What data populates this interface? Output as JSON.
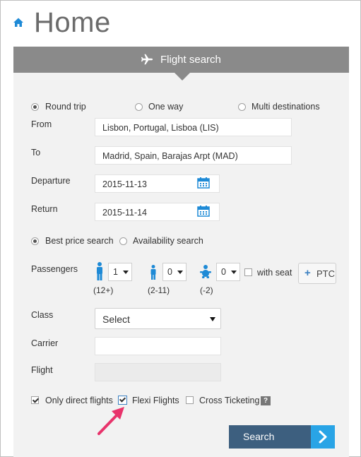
{
  "page": {
    "title": "Home"
  },
  "panel": {
    "title": "Flight search"
  },
  "trip_type": {
    "options": [
      "Round trip",
      "One way",
      "Multi destinations"
    ],
    "selected": "Round trip"
  },
  "from": {
    "label": "From",
    "value": "Lisbon, Portugal, Lisboa (LIS)"
  },
  "to": {
    "label": "To",
    "value": "Madrid, Spain, Barajas Arpt (MAD)"
  },
  "departure": {
    "label": "Departure",
    "value": "2015-11-13"
  },
  "return": {
    "label": "Return",
    "value": "2015-11-14"
  },
  "search_mode": {
    "options": [
      "Best price search",
      "Availability search"
    ],
    "selected": "Best price search"
  },
  "passengers": {
    "label": "Passengers",
    "adult": {
      "value": "1",
      "caption": "(12+)"
    },
    "child": {
      "value": "0",
      "caption": "(2-11)"
    },
    "infant": {
      "value": "0",
      "caption": "(-2)"
    },
    "with_seat_label": "with seat",
    "with_seat_checked": false,
    "ptc_label": "PTC"
  },
  "class": {
    "label": "Class",
    "value": "Select"
  },
  "carrier": {
    "label": "Carrier",
    "value": ""
  },
  "flight": {
    "label": "Flight",
    "value": ""
  },
  "options": {
    "direct_label": "Only direct flights",
    "direct_checked": true,
    "flexi_label": "Flexi Flights",
    "flexi_checked": true,
    "cross_label": "Cross Ticketing",
    "cross_checked": false,
    "help_glyph": "?"
  },
  "search_button": {
    "label": "Search"
  },
  "colors": {
    "accent": "#29a4e6",
    "header_bg": "#8a8a8a",
    "search_bg": "#3d5f7f",
    "pointer": "#e8336b",
    "home_icon": "#1e8ad6"
  }
}
